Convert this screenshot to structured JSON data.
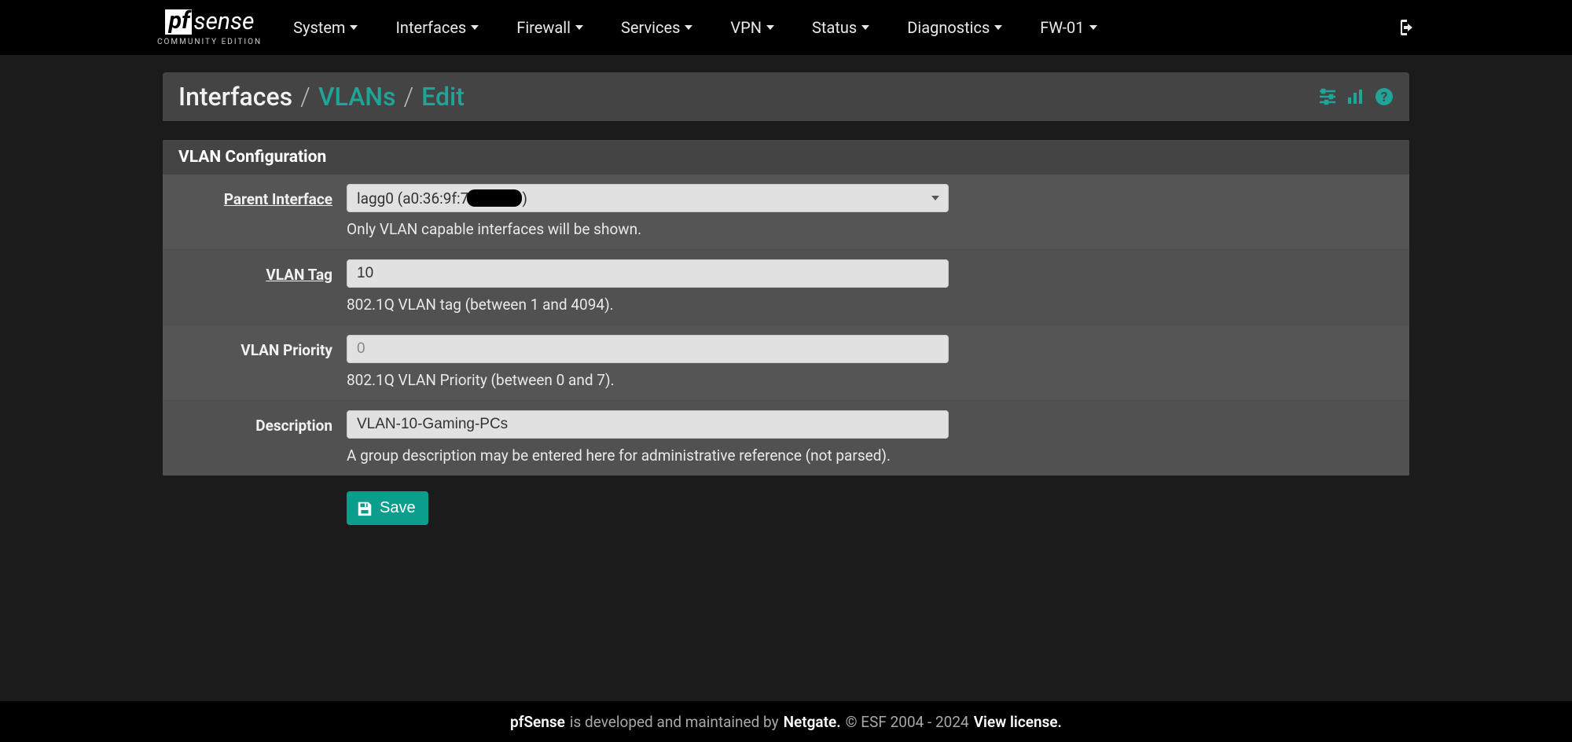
{
  "nav": {
    "logo_pf": "pf",
    "logo_sense": "sense",
    "logo_sub": "COMMUNITY EDITION",
    "items": [
      "System",
      "Interfaces",
      "Firewall",
      "Services",
      "VPN",
      "Status",
      "Diagnostics",
      "FW-01"
    ]
  },
  "breadcrumb": {
    "root": "Interfaces",
    "mid": "VLANs",
    "leaf": "Edit"
  },
  "panel": {
    "title": "VLAN Configuration",
    "fields": {
      "parent": {
        "label": "Parent Interface",
        "value_prefix": "lagg0 (a0:36:9f:7",
        "value_suffix": ")",
        "help": "Only VLAN capable interfaces will be shown."
      },
      "tag": {
        "label": "VLAN Tag",
        "value": "10",
        "help": "802.1Q VLAN tag (between 1 and 4094)."
      },
      "priority": {
        "label": "VLAN Priority",
        "placeholder": "0",
        "value": "",
        "help": "802.1Q VLAN Priority (between 0 and 7)."
      },
      "description": {
        "label": "Description",
        "value": "VLAN-10-Gaming-PCs",
        "help": "A group description may be entered here for administrative reference (not parsed)."
      }
    },
    "save": "Save"
  },
  "footer": {
    "p1": "pfSense",
    "p2": " is developed and maintained by ",
    "p3": "Netgate.",
    "p4": " © ESF 2004 - 2024 ",
    "p5": "View license."
  },
  "colors": {
    "accent": "#1fa598",
    "save": "#0b9e8c"
  }
}
